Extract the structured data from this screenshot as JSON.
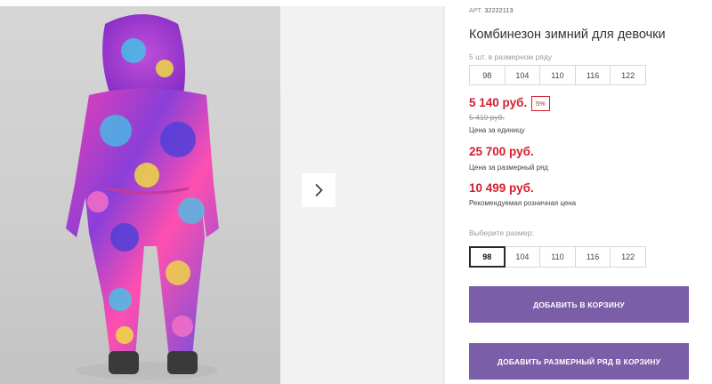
{
  "gallery": {
    "image_alt": "Комбинезон зимний для девочки",
    "next_icon": "chevron-right-icon"
  },
  "product": {
    "article_label": "АРТ.",
    "article_value": "32222113",
    "title": "Комбинезон зимний для девочки",
    "pack_label": "5 шт. в размерном ряду",
    "pack_sizes": [
      "98",
      "104",
      "110",
      "116",
      "122"
    ],
    "price_unit": "5 140 руб.",
    "discount": "5%",
    "old_price": "5 410 руб.",
    "price_unit_note": "Цена за единицу",
    "price_row": "25 700 руб.",
    "price_row_note": "Цена за размерный ряд",
    "price_retail": "10 499 руб.",
    "price_retail_note": "Рекомендуемая розничная цена",
    "choose_size_label": "Выберите размер:",
    "size_options": [
      "98",
      "104",
      "110",
      "116",
      "122"
    ],
    "selected_size": "98"
  },
  "actions": {
    "add_to_cart": "ДОБАВИТЬ В КОРЗИНУ",
    "add_row_to_cart": "ДОБАВИТЬ РАЗМЕРНЫЙ РЯД В КОРЗИНУ"
  },
  "colors": {
    "accent": "#7a5ea7",
    "price": "#d31f2e"
  }
}
